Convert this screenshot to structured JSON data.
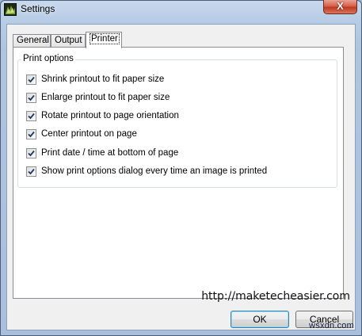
{
  "window": {
    "title": "Settings",
    "close_label": "X"
  },
  "tabs": [
    {
      "label": "General",
      "active": false
    },
    {
      "label": "Output",
      "active": false
    },
    {
      "label": "Printer",
      "active": true
    }
  ],
  "print_options": {
    "group_label": "Print options",
    "items": [
      {
        "label": "Shrink printout to fit paper size",
        "checked": true
      },
      {
        "label": "Enlarge printout to fit paper size",
        "checked": true
      },
      {
        "label": "Rotate printout to page orientation",
        "checked": true
      },
      {
        "label": "Center printout on page",
        "checked": true
      },
      {
        "label": "Print date / time at bottom of page",
        "checked": true
      },
      {
        "label": "Show print options dialog every time an image is printed",
        "checked": true
      }
    ]
  },
  "watermark": "http://maketecheasier.com",
  "buttons": {
    "ok": "OK",
    "cancel": "Cancel"
  },
  "corner_logo": "wsxdn.com",
  "colors": {
    "check": "#1f3a5f",
    "close_button": "#c0391f"
  }
}
